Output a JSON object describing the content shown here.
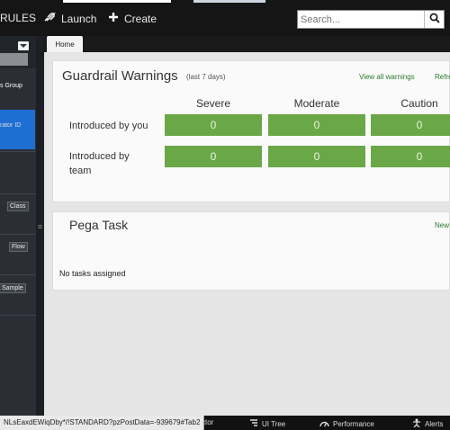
{
  "topbar": {
    "rules_label": "RULES",
    "launch_label": "Launch",
    "create_label": "Create",
    "search_placeholder": "Search..."
  },
  "sidebar": {
    "items": [
      {
        "label": "s Group"
      },
      {
        "label": "rator ID"
      },
      {
        "label": "Class"
      },
      {
        "label": "Flow"
      },
      {
        "label": "Sample"
      }
    ]
  },
  "tabs": [
    {
      "label": "Home"
    }
  ],
  "guardrail": {
    "title": "Guardrail Warnings",
    "subtitle": "(last 7 days)",
    "view_all": "View all warnings",
    "refresh": "Refre",
    "columns": [
      "Severe",
      "Moderate",
      "Caution"
    ],
    "rows": [
      {
        "label": "Introduced by you",
        "values": [
          "0",
          "0",
          "0"
        ]
      },
      {
        "label": "Introduced by team",
        "values": [
          "0",
          "0",
          "0"
        ]
      }
    ]
  },
  "task": {
    "title": "Pega Task",
    "new_label": "New",
    "empty_message": "No tasks assigned"
  },
  "statusbar": {
    "url": "NLsEaxdEWiqDby*/!STANDARD?pzPostData=-939679#Tab2",
    "items": [
      {
        "label": "ctor"
      },
      {
        "label": "UI Tree"
      },
      {
        "label": "Performance"
      },
      {
        "label": "Alerts"
      }
    ]
  },
  "colors": {
    "accent_blue": "#1f6fd3",
    "guardrail_green": "#6aa746",
    "link_green": "#2a7a2a"
  }
}
